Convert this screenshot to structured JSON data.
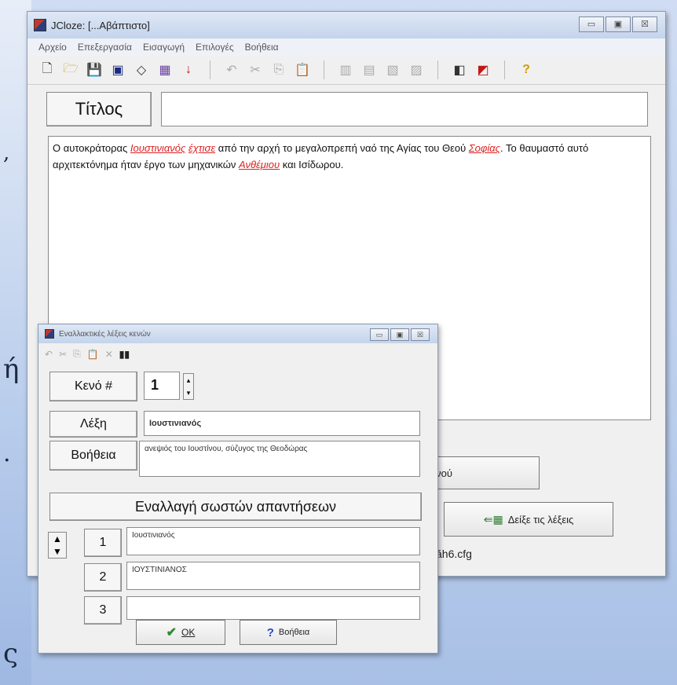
{
  "main_window": {
    "title": "JCloze: [...Αβάπτιστο]",
    "controls": {
      "minimize": "▭",
      "maximize": "▣",
      "close": "☒"
    },
    "menu": [
      "Αρχείο",
      "Επεξεργασία",
      "Εισαγωγή",
      "Επιλογές",
      "Βοήθεια"
    ],
    "title_button": "Τίτλος",
    "title_value": "",
    "text": {
      "p1": "Ο αυτοκράτορας ",
      "g1": "Ιουστινιανός",
      "p2": " ",
      "g2": "έχτισε",
      "p3": " από την αρχή το μεγαλοπρεπή ναό της Αγίας του Θεού ",
      "g3": "Σοφίας",
      "p4": ". Το θαυμαστό αυτό αρχιτεκτόνημα ήταν έργο των μηχανικών ",
      "g4": "Ανθέμιου",
      "p5": " και Ισίδωρου."
    },
    "gap_button_partial": "αφή κενού",
    "show_words_button": "Δείξε τις λέξεις",
    "status_partial": "ăh6.cfg"
  },
  "dialog": {
    "title": "Εναλλακτικές λέξεις κενών",
    "gap_label": "Κενό #",
    "gap_number": "1",
    "word_label": "Λέξη",
    "word_value": "Ιουστινιανός",
    "hint_label": "Βοήθεια",
    "hint_value": "ανεψιός του Ιουστίνου, σύζυγος της Θεοδώρας",
    "alternates_header": "Εναλλαγή σωστών απαντήσεων",
    "alternates": [
      {
        "num": "1",
        "value": "Ιουστινιανός"
      },
      {
        "num": "2",
        "value": "ΙΟΥΣΤΙΝΙΑΝΟΣ"
      },
      {
        "num": "3",
        "value": ""
      }
    ],
    "ok_label": "OK",
    "help_label": "Βοήθεια"
  },
  "background_chars": [
    ",",
    "ή",
    ".",
    "ς"
  ],
  "colors": {
    "gap_text": "#d22222",
    "titlebar": "#c3d4ec",
    "accent_check": "#2e8b2e",
    "help_icon": "#1f4fbf"
  }
}
